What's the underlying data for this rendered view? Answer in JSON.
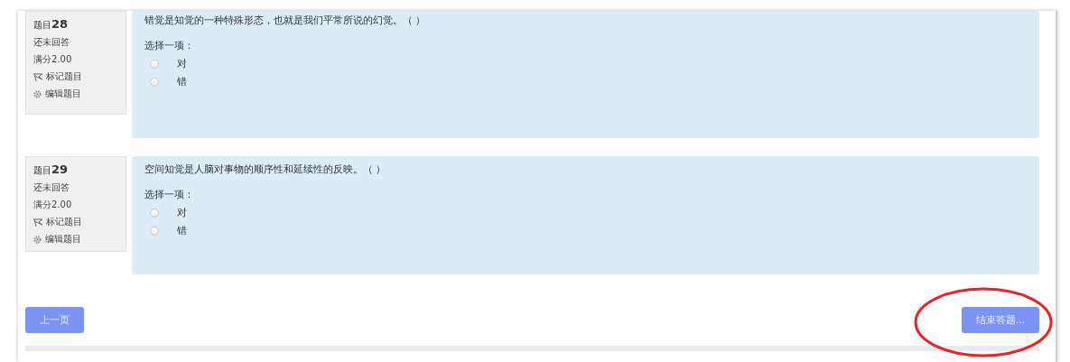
{
  "questions": [
    {
      "label": "题目",
      "number": "28",
      "status": "还未回答",
      "score": "满分2.00",
      "flag_link": "标记题目",
      "edit_link": "编辑题目",
      "text": "错觉是知觉的一种特殊形态，也就是我们平常所说的幻觉。（ ）",
      "prompt": "选择一项：",
      "options": [
        {
          "label": "对",
          "selected": false
        },
        {
          "label": "错",
          "selected": false
        }
      ]
    },
    {
      "label": "题目",
      "number": "29",
      "status": "还未回答",
      "score": "满分2.00",
      "flag_link": "标记题目",
      "edit_link": "编辑题目",
      "text": "空间知觉是人脑对事物的顺序性和延续性的反映。（ ）",
      "prompt": "选择一项：",
      "options": [
        {
          "label": "对",
          "selected": false
        },
        {
          "label": "错",
          "selected": false
        }
      ]
    }
  ],
  "buttons": {
    "previous": "上一页",
    "finish": "结束答题..."
  }
}
